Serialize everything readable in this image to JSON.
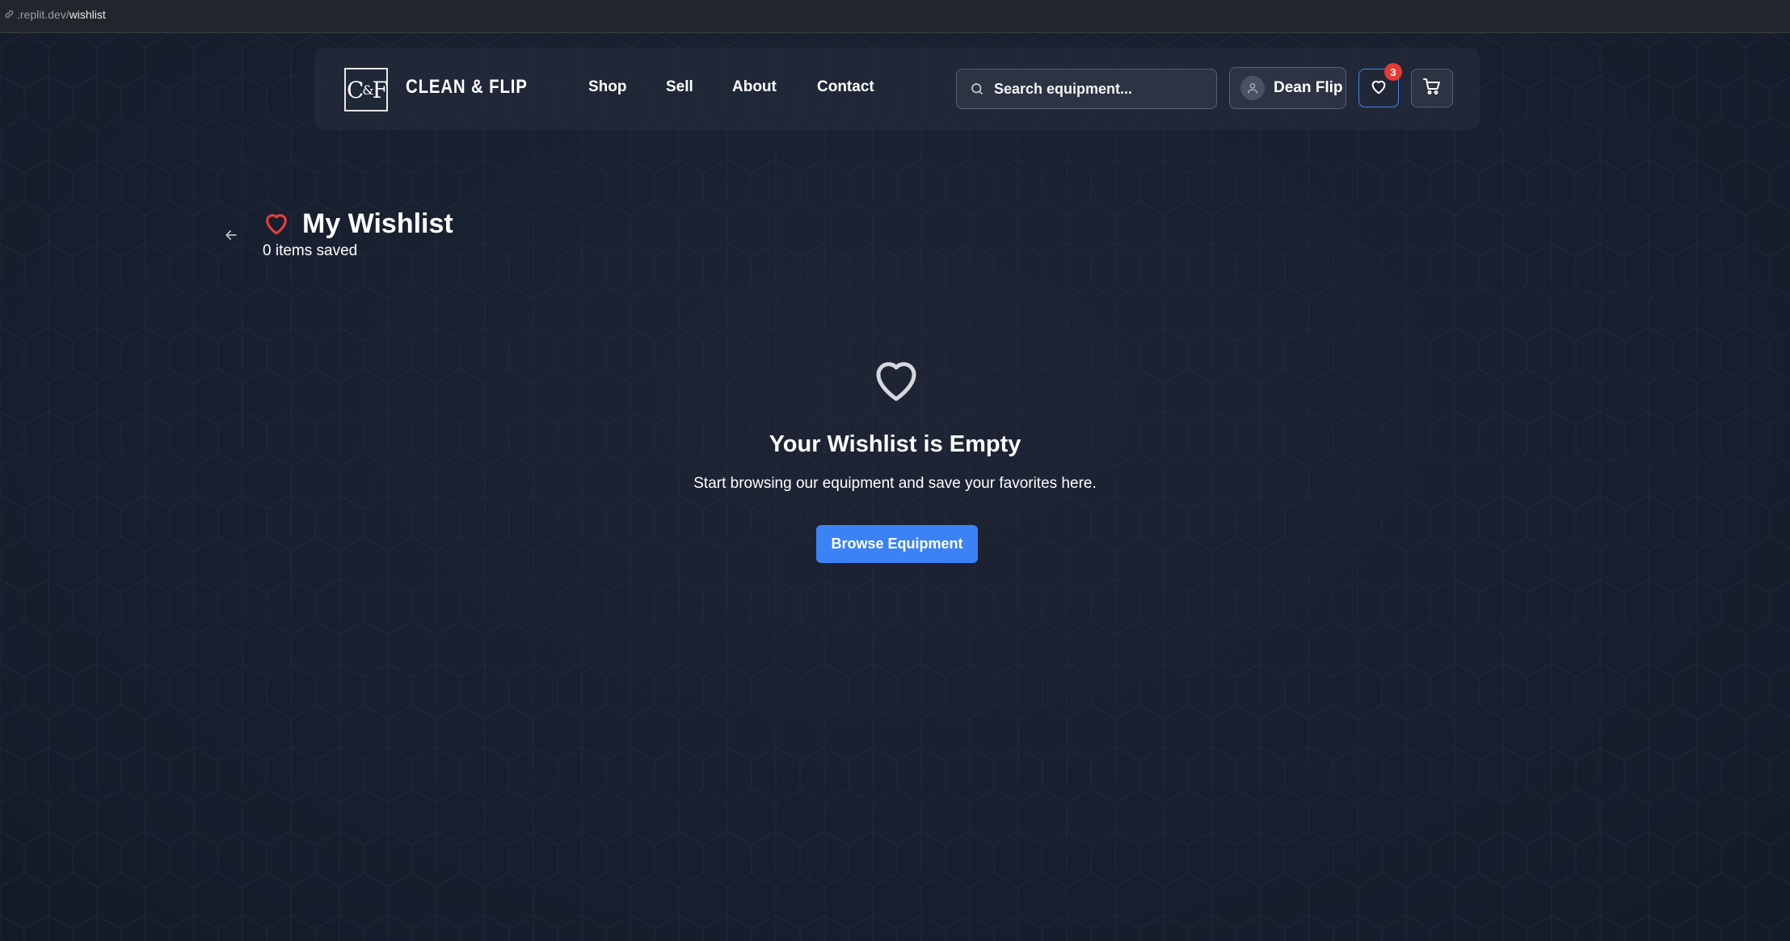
{
  "browser": {
    "url_host": ".replit.dev/",
    "url_path": "wishlist"
  },
  "header": {
    "logo_left": "C",
    "logo_amp": "&",
    "logo_right": "F",
    "brand": "CLEAN & FLIP",
    "nav": [
      {
        "label": "Shop"
      },
      {
        "label": "Sell"
      },
      {
        "label": "About"
      },
      {
        "label": "Contact"
      }
    ],
    "search_placeholder": "Search equipment...",
    "user_name": "Dean Flip",
    "wishlist_count": "3"
  },
  "wishlist": {
    "title": "My Wishlist",
    "subtitle": "0 items saved",
    "empty_title": "Your Wishlist is Empty",
    "empty_desc": "Start browsing our equipment and save your favorites here.",
    "browse_label": "Browse Equipment"
  },
  "colors": {
    "accent": "#3b82f6",
    "heart": "#e53e3e",
    "badge": "#e53935"
  }
}
